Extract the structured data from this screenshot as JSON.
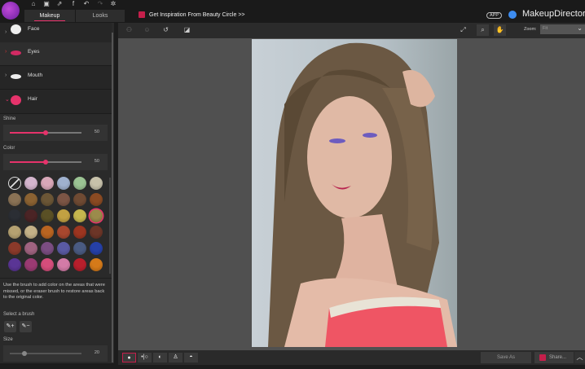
{
  "header": {
    "tabs": [
      "Makeup",
      "Looks"
    ],
    "inspiration": "Get Inspiration From Beauty Circle >>",
    "app_badge": "APP",
    "brand": "MakeupDirector",
    "icons": [
      "home-icon",
      "save-icon",
      "share-icon",
      "facebook-icon",
      "undo-icon",
      "redo-icon",
      "settings-icon"
    ]
  },
  "sidebar": {
    "sections": [
      {
        "label": "Face"
      },
      {
        "label": "Eyes"
      },
      {
        "label": "Mouth"
      },
      {
        "label": "Hair"
      }
    ],
    "shine": {
      "label": "Shine",
      "value": "50",
      "percent": 50
    },
    "color": {
      "label": "Color",
      "value": "50",
      "percent": 50
    },
    "swatch_colors": [
      "none",
      "#d4b5cd",
      "#d8a7b8",
      "#9fb1cf",
      "#9bc393",
      "#c7c1aa",
      "#8a7255",
      "#8b6232",
      "#6b5636",
      "#7c5545",
      "#6f4a33",
      "#8a4a22",
      "#2b2e34",
      "#4b2425",
      "#5a5025",
      "#c2a142",
      "#c6b74e",
      "#9b8b4b",
      "#b5a171",
      "#c4b187",
      "#b96421",
      "#a8472e",
      "#9c3520",
      "#6c3527",
      "#8b3a2a",
      "#a06380",
      "#7b4d82",
      "#5a5aa3",
      "#4a5b82",
      "#2540a8",
      "#5a3595",
      "#9a3a72",
      "#d54d7b",
      "#d37ba7",
      "#b81f2c",
      "#d57a19"
    ],
    "selected_swatch": 17,
    "description": "Use the brush to add color on the areas that were missed, or the eraser brush to restore areas back to the original color.",
    "brush_label": "Select a brush",
    "size": {
      "label": "Size",
      "value": "20",
      "percent": 20
    }
  },
  "toolbar": {
    "zoom_label": "Zoom:",
    "zoom_value": "Fit"
  },
  "bottom": {
    "save_as": "Save As",
    "share": "Share..."
  },
  "colors": {
    "accent": "#e6336b"
  }
}
